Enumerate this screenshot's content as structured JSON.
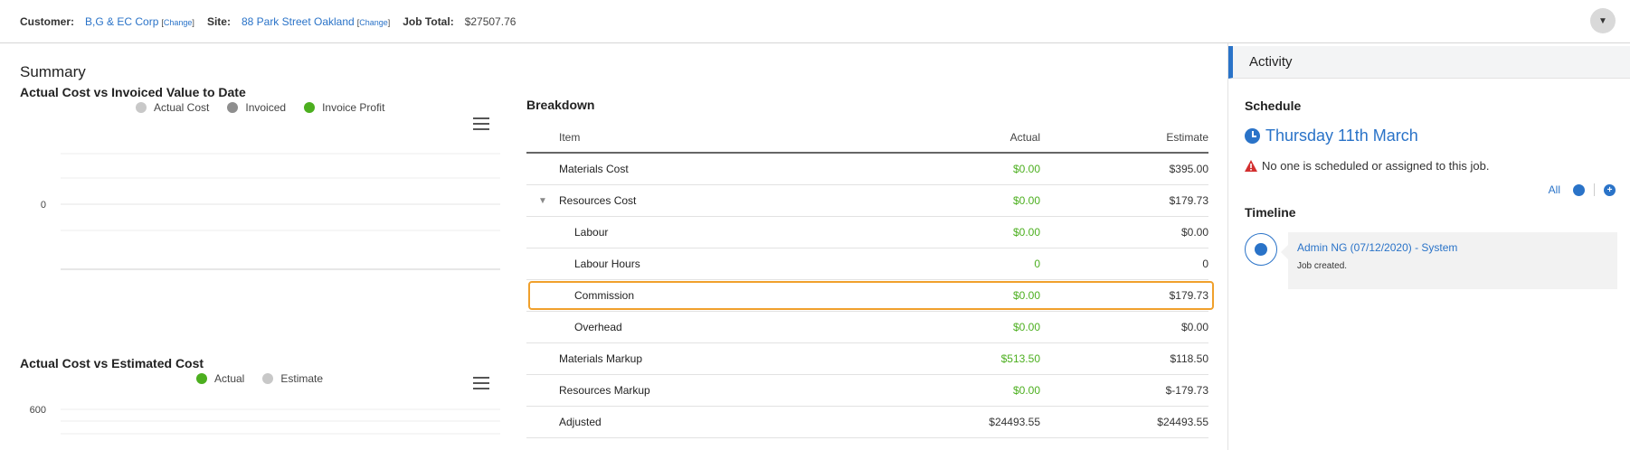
{
  "topbar": {
    "customer_label": "Customer:",
    "customer_value": "B,G & EC Corp",
    "site_label": "Site:",
    "site_value": "88 Park Street Oakland",
    "change_label": "Change",
    "job_total_label": "Job Total:",
    "job_total_value": "$27507.76"
  },
  "summary": {
    "title": "Summary",
    "chart1": {
      "title": "Actual Cost vs Invoiced Value to Date",
      "legend": [
        {
          "label": "Actual Cost",
          "color": "#c8c8c8"
        },
        {
          "label": "Invoiced",
          "color": "#8e8e8e"
        },
        {
          "label": "Invoice Profit",
          "color": "#4caf1f"
        }
      ]
    },
    "chart2": {
      "title": "Actual Cost vs Estimated Cost",
      "legend": [
        {
          "label": "Actual",
          "color": "#4caf1f"
        },
        {
          "label": "Estimate",
          "color": "#c8c8c8"
        }
      ]
    }
  },
  "chart_data": [
    {
      "type": "bar",
      "title": "Actual Cost vs Invoiced Value to Date",
      "series": [
        {
          "name": "Actual Cost",
          "values": []
        },
        {
          "name": "Invoiced",
          "values": []
        },
        {
          "name": "Invoice Profit",
          "values": []
        }
      ],
      "y_ticks": [
        "0"
      ],
      "legend": "top",
      "grid": true
    },
    {
      "type": "bar",
      "title": "Actual Cost vs Estimated Cost",
      "series": [
        {
          "name": "Actual",
          "values": []
        },
        {
          "name": "Estimate",
          "values": []
        }
      ],
      "y_ticks": [
        "600"
      ],
      "legend": "top",
      "grid": true
    }
  ],
  "breakdown": {
    "title": "Breakdown",
    "headers": {
      "item": "Item",
      "actual": "Actual",
      "estimate": "Estimate"
    },
    "rows": [
      {
        "item": "Materials Cost",
        "actual": "$0.00",
        "estimate": "$395.00"
      },
      {
        "item": "Resources Cost",
        "actual": "$0.00",
        "estimate": "$179.73",
        "toggle": "▼"
      },
      {
        "item": "Labour",
        "actual": "$0.00",
        "estimate": "$0.00"
      },
      {
        "item": "Labour Hours",
        "actual": "0",
        "estimate": "0"
      },
      {
        "item": "Commission",
        "actual": "$0.00",
        "estimate": "$179.73"
      },
      {
        "item": "Overhead",
        "actual": "$0.00",
        "estimate": "$0.00"
      },
      {
        "item": "Materials Markup",
        "actual": "$513.50",
        "estimate": "$118.50"
      },
      {
        "item": "Resources Markup",
        "actual": "$0.00",
        "estimate": "$-179.73"
      },
      {
        "item": "Adjusted",
        "actual": "$24493.55",
        "estimate": "$24493.55"
      }
    ]
  },
  "activity": {
    "title": "Activity",
    "schedule_title": "Schedule",
    "schedule_date": "Thursday 11th March",
    "schedule_warning": "No one is scheduled or assigned to this job.",
    "timeline_title": "Timeline",
    "timeline_filter": "All",
    "timeline_entry": {
      "who": "Admin NG (07/12/2020) - System",
      "message": "Job created."
    }
  },
  "colors": {
    "accent": "#2a73c8",
    "positive": "#4caf1f",
    "warning": "#d32f2f",
    "highlight": "#f0a02c"
  }
}
